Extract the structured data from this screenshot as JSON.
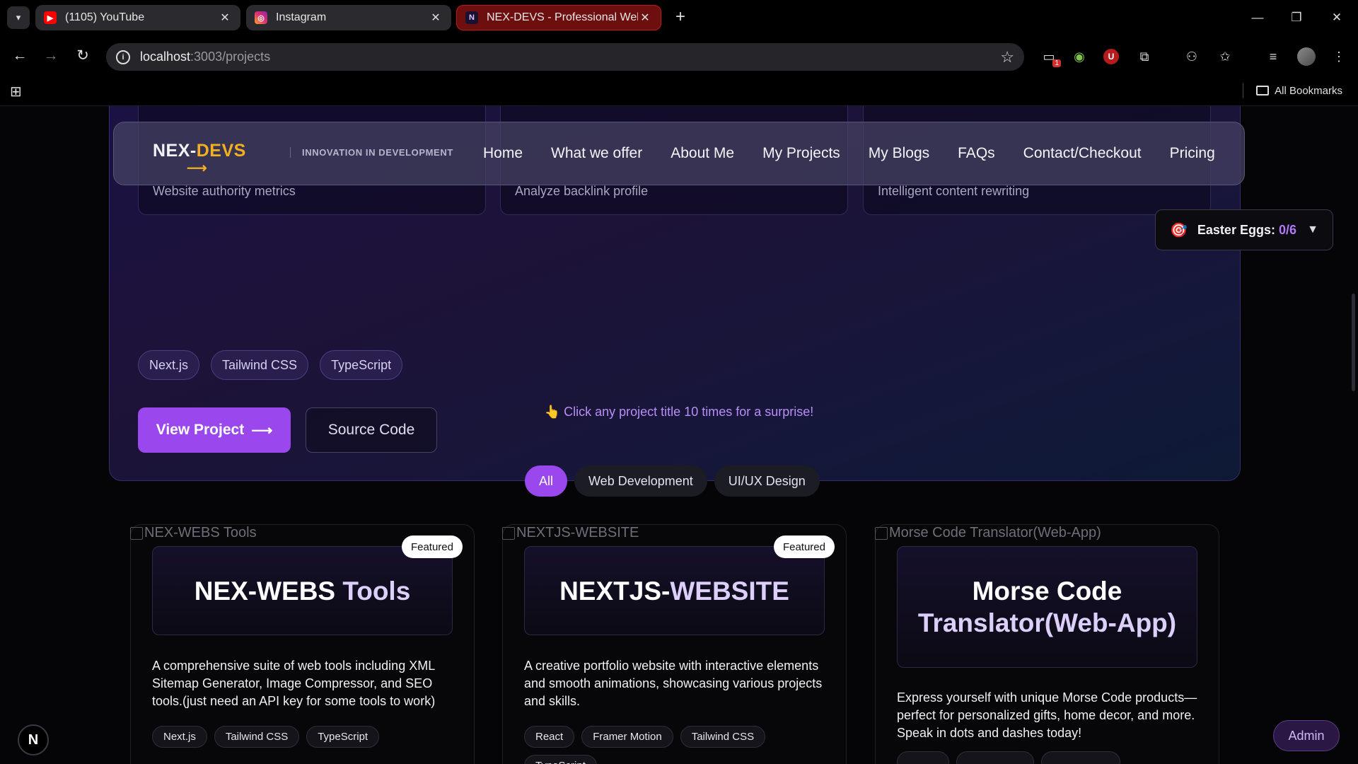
{
  "browser": {
    "tabs": [
      {
        "title": "(1105) YouTube",
        "icon": "youtube-icon"
      },
      {
        "title": "Instagram",
        "icon": "instagram-icon"
      },
      {
        "title": "NEX-DEVS - Professional Web/A",
        "icon": "nex-devs-favicon",
        "active": true
      }
    ],
    "address": {
      "host": "localhost",
      "path": ":3003/projects"
    },
    "bookmarks_label": "All Bookmarks",
    "extension_badge": "1"
  },
  "hero": {
    "features": [
      {
        "desc": "Website authority metrics"
      },
      {
        "desc": "Analyze backlink profile"
      },
      {
        "desc": "Intelligent content rewriting"
      }
    ],
    "tags": [
      "Next.js",
      "Tailwind CSS",
      "TypeScript"
    ],
    "view_project_label": "View Project",
    "view_project_arrow": "⟶",
    "source_code_label": "Source Code"
  },
  "navbar": {
    "brand_part1": "NEX-",
    "brand_part2": "DEVS",
    "tagline": "INNOVATION IN DEVELOPMENT",
    "links": [
      "Home",
      "What we offer",
      "About Me",
      "My Projects",
      "My Blogs",
      "FAQs",
      "Contact/Checkout",
      "Pricing"
    ]
  },
  "easter_eggs": {
    "label": "Easter Eggs: ",
    "count": "0/6"
  },
  "hint": "👆 Click any project title 10 times for a surprise!",
  "filters": [
    {
      "label": "All",
      "active": true
    },
    {
      "label": "Web Development",
      "active": false
    },
    {
      "label": "UI/UX Design",
      "active": false
    }
  ],
  "projects": [
    {
      "image_alt": "NEX-WEBS Tools",
      "title_part1": "NEX-WEBS ",
      "title_part2": "Tools",
      "badge": "Featured",
      "description": "A comprehensive suite of web tools including XML Sitemap Generator, Image Compressor, and SEO tools.(just need an API key for some tools to work)",
      "tags": [
        "Next.js",
        "Tailwind CSS",
        "TypeScript"
      ]
    },
    {
      "image_alt": "NEXTJS-WEBSITE",
      "title_part1": "NEXTJS-",
      "title_part2": "WEBSITE",
      "badge": "Featured",
      "description": "A creative portfolio website with interactive elements and smooth animations, showcasing various projects and skills.",
      "tags": [
        "React",
        "Framer Motion",
        "Tailwind CSS",
        "TypeScript"
      ]
    },
    {
      "image_alt": "Morse Code Translator(Web-App)",
      "title_part1": "Morse Code ",
      "title_part2": "Translator(Web-App)",
      "badge": "",
      "description": "Express yourself with unique Morse Code products—perfect for personalized gifts, home decor, and more. Speak in dots and dashes today!",
      "tags": [
        "",
        "",
        ""
      ]
    }
  ],
  "corner_badge": "N",
  "admin_label": "Admin"
}
